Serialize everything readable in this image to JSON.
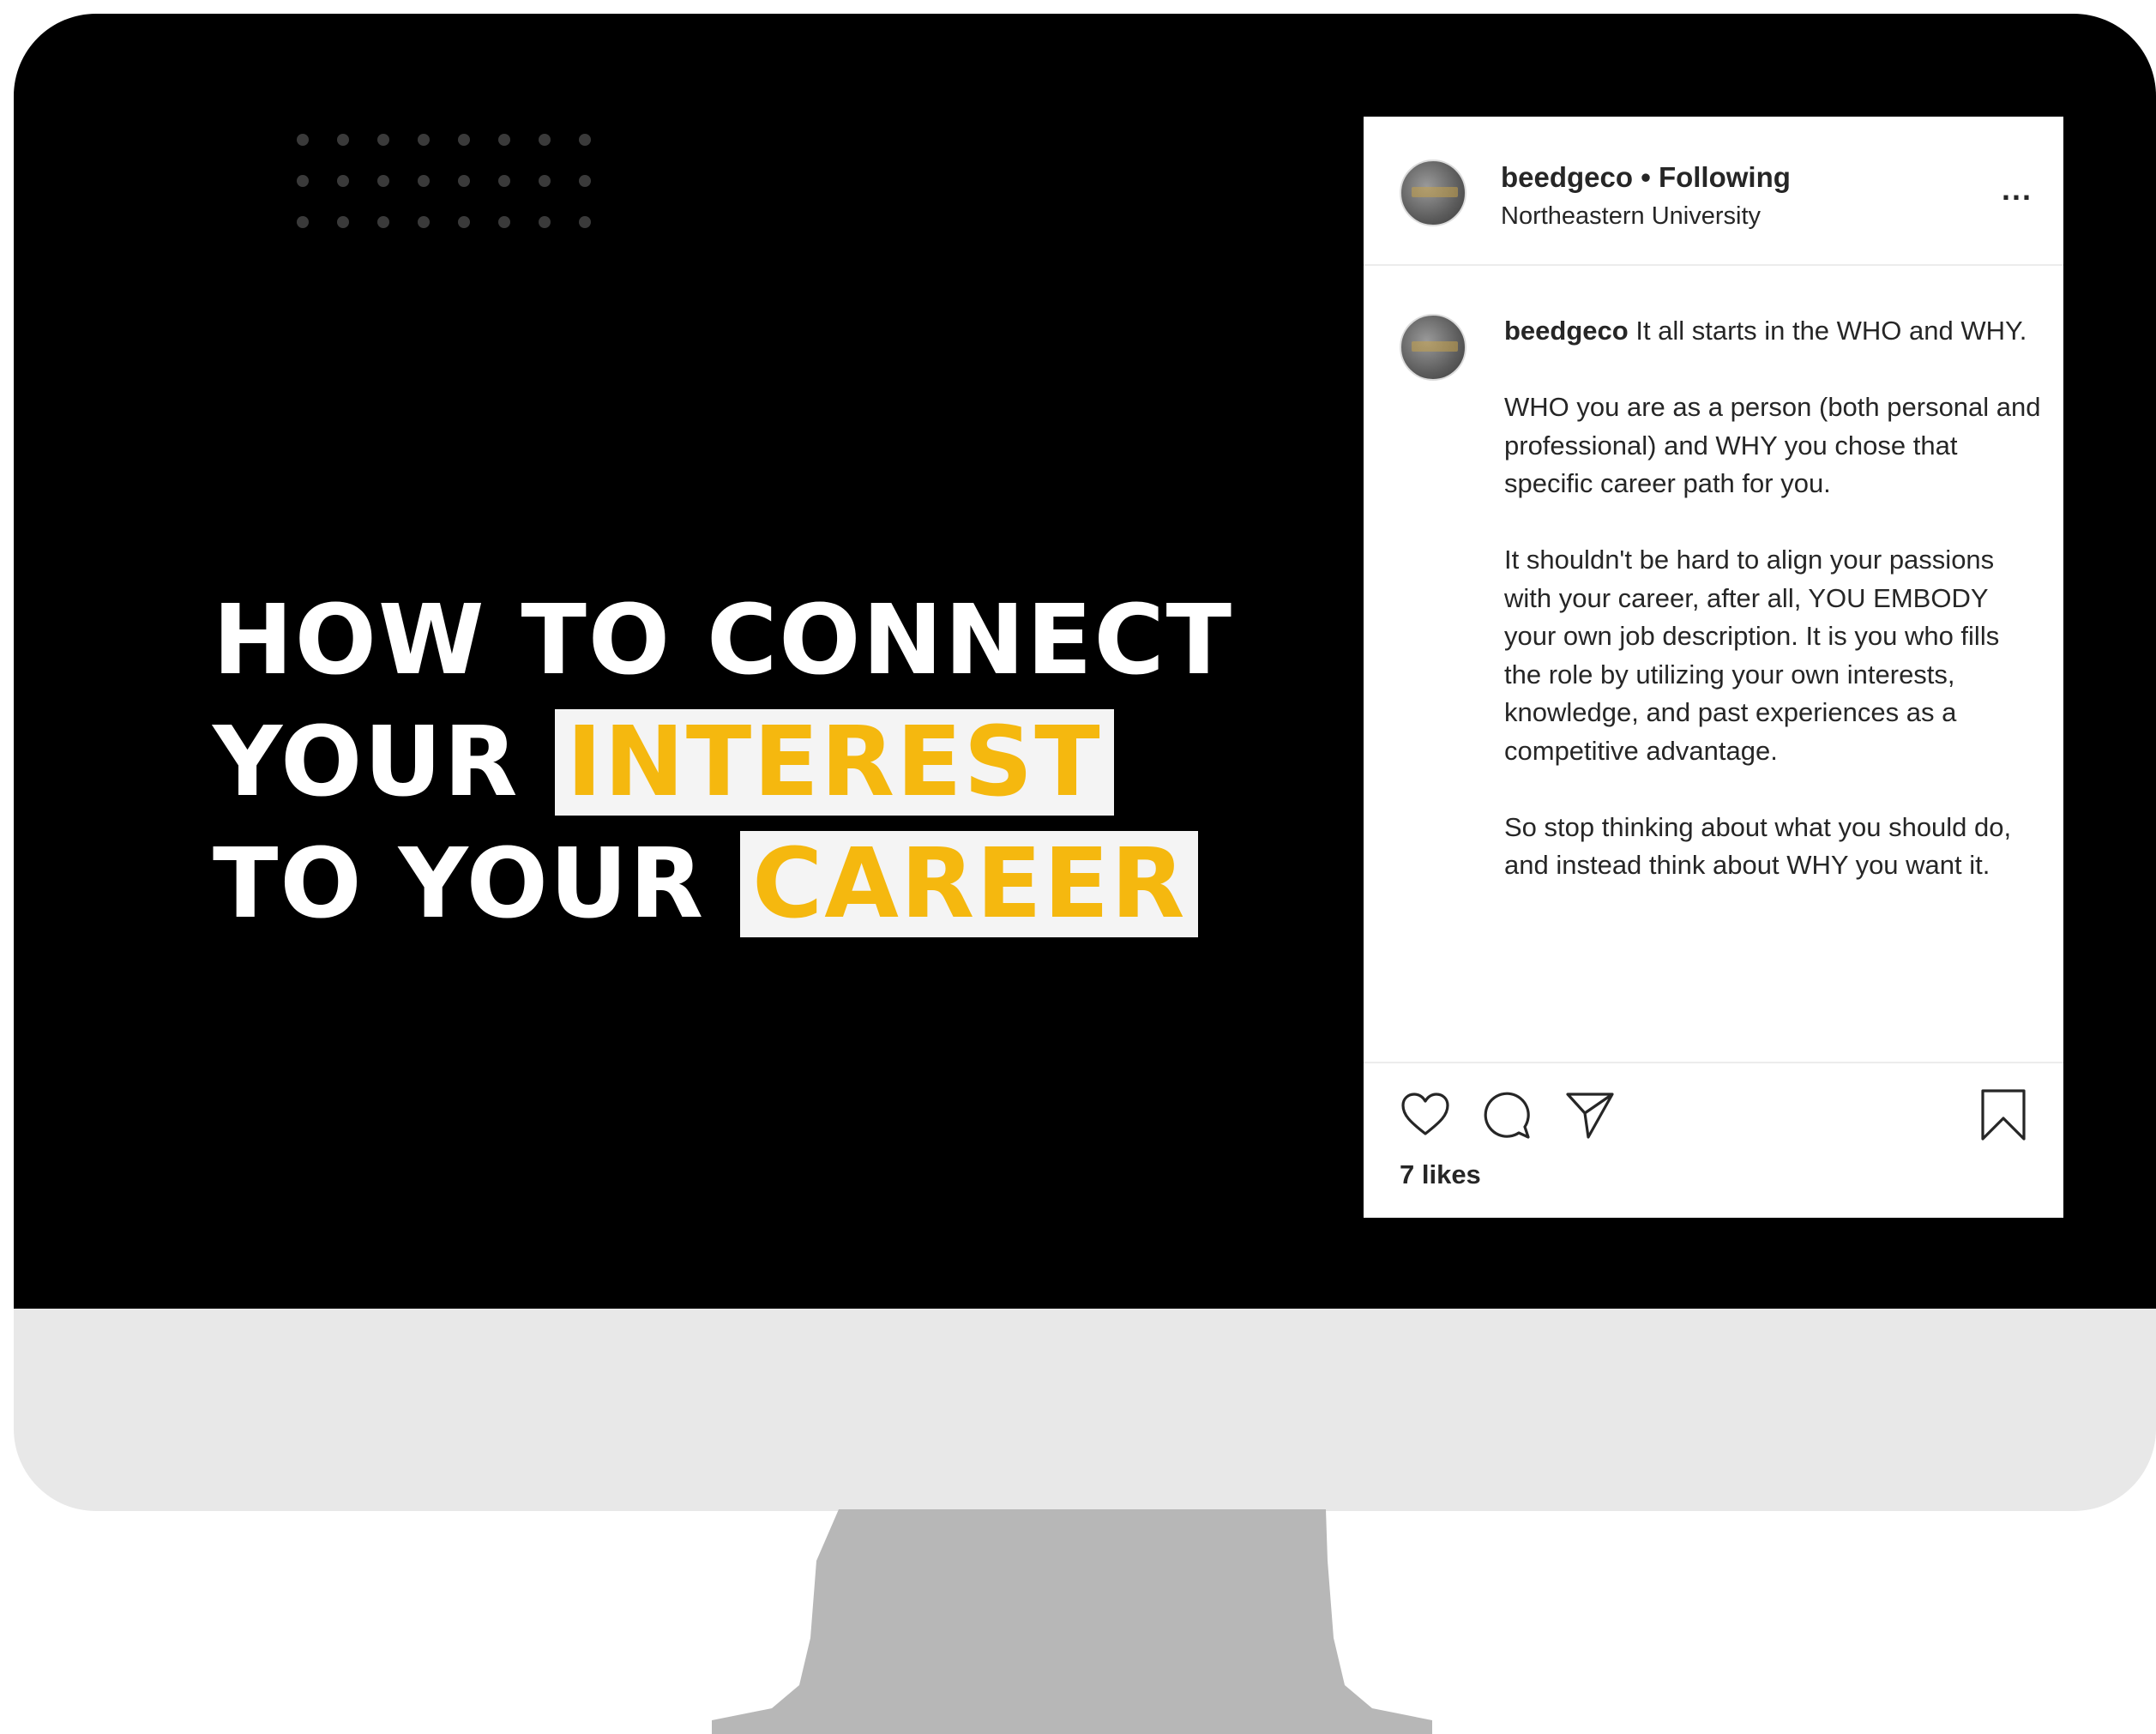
{
  "headline": {
    "line1": "HOW TO CONNECT",
    "line2_prefix": "YOUR",
    "line2_highlight": "INTEREST",
    "line3_prefix": "TO YOUR",
    "line3_highlight": "CAREER",
    "highlight_color": "#f5b80f"
  },
  "post": {
    "username": "beedgeco",
    "follow_status": "• Following",
    "location": "Northeastern University",
    "more_label": "...",
    "caption": {
      "username": "beedgeco",
      "paragraph1": "It all starts in the WHO and WHY.",
      "paragraph2": "WHO you are as a person (both personal and professional) and WHY you chose that specific career path for you.",
      "paragraph3": "It shouldn't be hard to align your passions with your career, after all, YOU EMBODY your own job description. It is you who fills the role by utilizing your own interests, knowledge, and past experiences as a competitive advantage.",
      "paragraph4": "So stop thinking about what you should do, and instead think about WHY you want it."
    },
    "likes": "7 likes",
    "icons": [
      "heart-icon",
      "comment-icon",
      "share-icon",
      "bookmark-icon"
    ]
  }
}
